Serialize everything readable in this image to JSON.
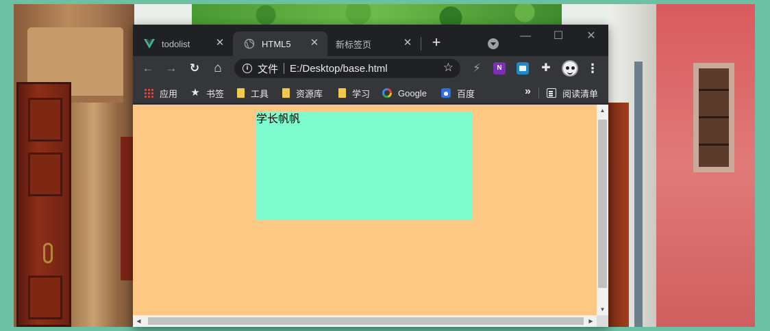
{
  "browser": {
    "tabs": [
      {
        "title": "todolist",
        "icon": "vue-icon",
        "active": false
      },
      {
        "title": "HTML5",
        "icon": "globe-icon",
        "active": true
      },
      {
        "title": "新标签页",
        "icon": "",
        "active": false
      }
    ],
    "close_glyph": "✕",
    "new_tab_glyph": "+",
    "window_controls": {
      "minimize": "—",
      "maximize": "☐",
      "close": "✕"
    }
  },
  "toolbar": {
    "back_glyph": "←",
    "forward_glyph": "→",
    "reload_glyph": "↻",
    "home_glyph": "⌂",
    "address": {
      "scheme_label": "文件",
      "url": "E:/Desktop/base.html",
      "info_glyph": "i",
      "star_glyph": "☆"
    },
    "bolt_glyph": "⚡",
    "onenote_label": "N",
    "puzzle_glyph": "✚",
    "menu_glyph": "⋮"
  },
  "bookmarks": {
    "items": [
      {
        "label": "应用",
        "icon": "apps-grid-icon"
      },
      {
        "label": "书签",
        "icon": "star-icon"
      },
      {
        "label": "工具",
        "icon": "folder-icon"
      },
      {
        "label": "资源库",
        "icon": "folder-icon"
      },
      {
        "label": "学习",
        "icon": "folder-icon"
      },
      {
        "label": "Google",
        "icon": "google-icon"
      },
      {
        "label": "百度",
        "icon": "baidu-icon"
      }
    ],
    "star_glyph": "★",
    "more_glyph": "»",
    "reading_list": "阅读清单"
  },
  "page": {
    "box_text": "学长帆帆",
    "background_color": "#fdc884",
    "box_color": "#7ffccf"
  },
  "scrollbar": {
    "up": "▲",
    "down": "▼",
    "left": "◀",
    "right": "▶"
  }
}
